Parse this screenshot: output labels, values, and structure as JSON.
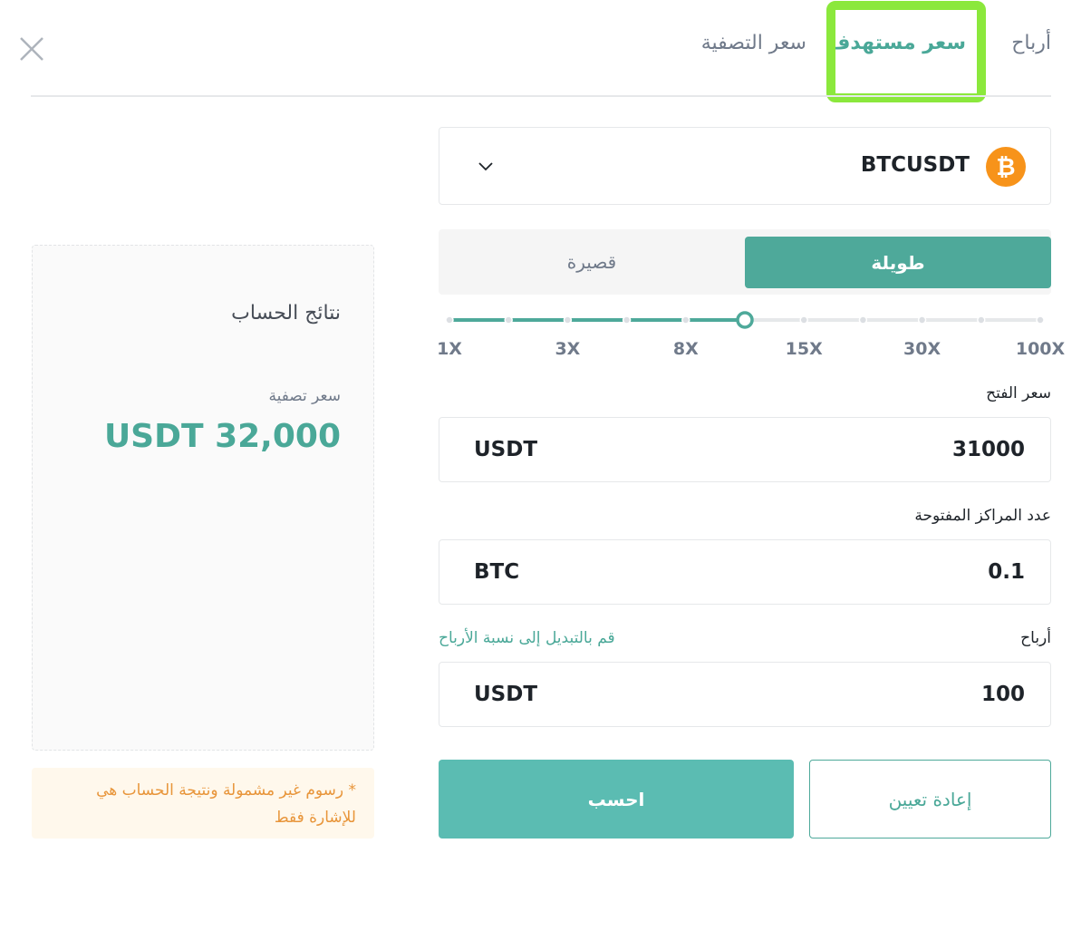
{
  "tabs": {
    "profit": "أرباح",
    "target_price": "سعر مستهدف",
    "liquidation_price": "سعر التصفية"
  },
  "symbol": {
    "name": "BTCUSDT",
    "icon": "bitcoin-icon"
  },
  "side": {
    "long": "طويلة",
    "short": "قصيرة",
    "selected": "long"
  },
  "leverage": {
    "labels": [
      "1X",
      "3X",
      "8X",
      "15X",
      "30X",
      "100X"
    ],
    "selected_step": 5,
    "steps": 11,
    "accent": "#4ea99a"
  },
  "fields": {
    "entry_price": {
      "label": "سعر الفتح",
      "value": "31000",
      "unit": "USDT"
    },
    "quantity": {
      "label": "عدد المراكز المفتوحة",
      "value": "0.1",
      "unit": "BTC"
    },
    "profit": {
      "label": "أرباح",
      "value": "100",
      "unit": "USDT",
      "switch_link": "قم بالتبديل إلى نسبة الأرباح"
    }
  },
  "buttons": {
    "calculate": "احسب",
    "reset": "إعادة تعيين"
  },
  "results": {
    "title": "نتائج الحساب",
    "liquidation_label": "سعر تصفية",
    "liquidation_value": "USDT 32,000"
  },
  "note": "* رسوم غير مشمولة ونتيجة الحساب هي للإشارة فقط",
  "colors": {
    "accent": "#4ea99a",
    "highlight": "#8be83c",
    "warning": "#e8953a"
  }
}
